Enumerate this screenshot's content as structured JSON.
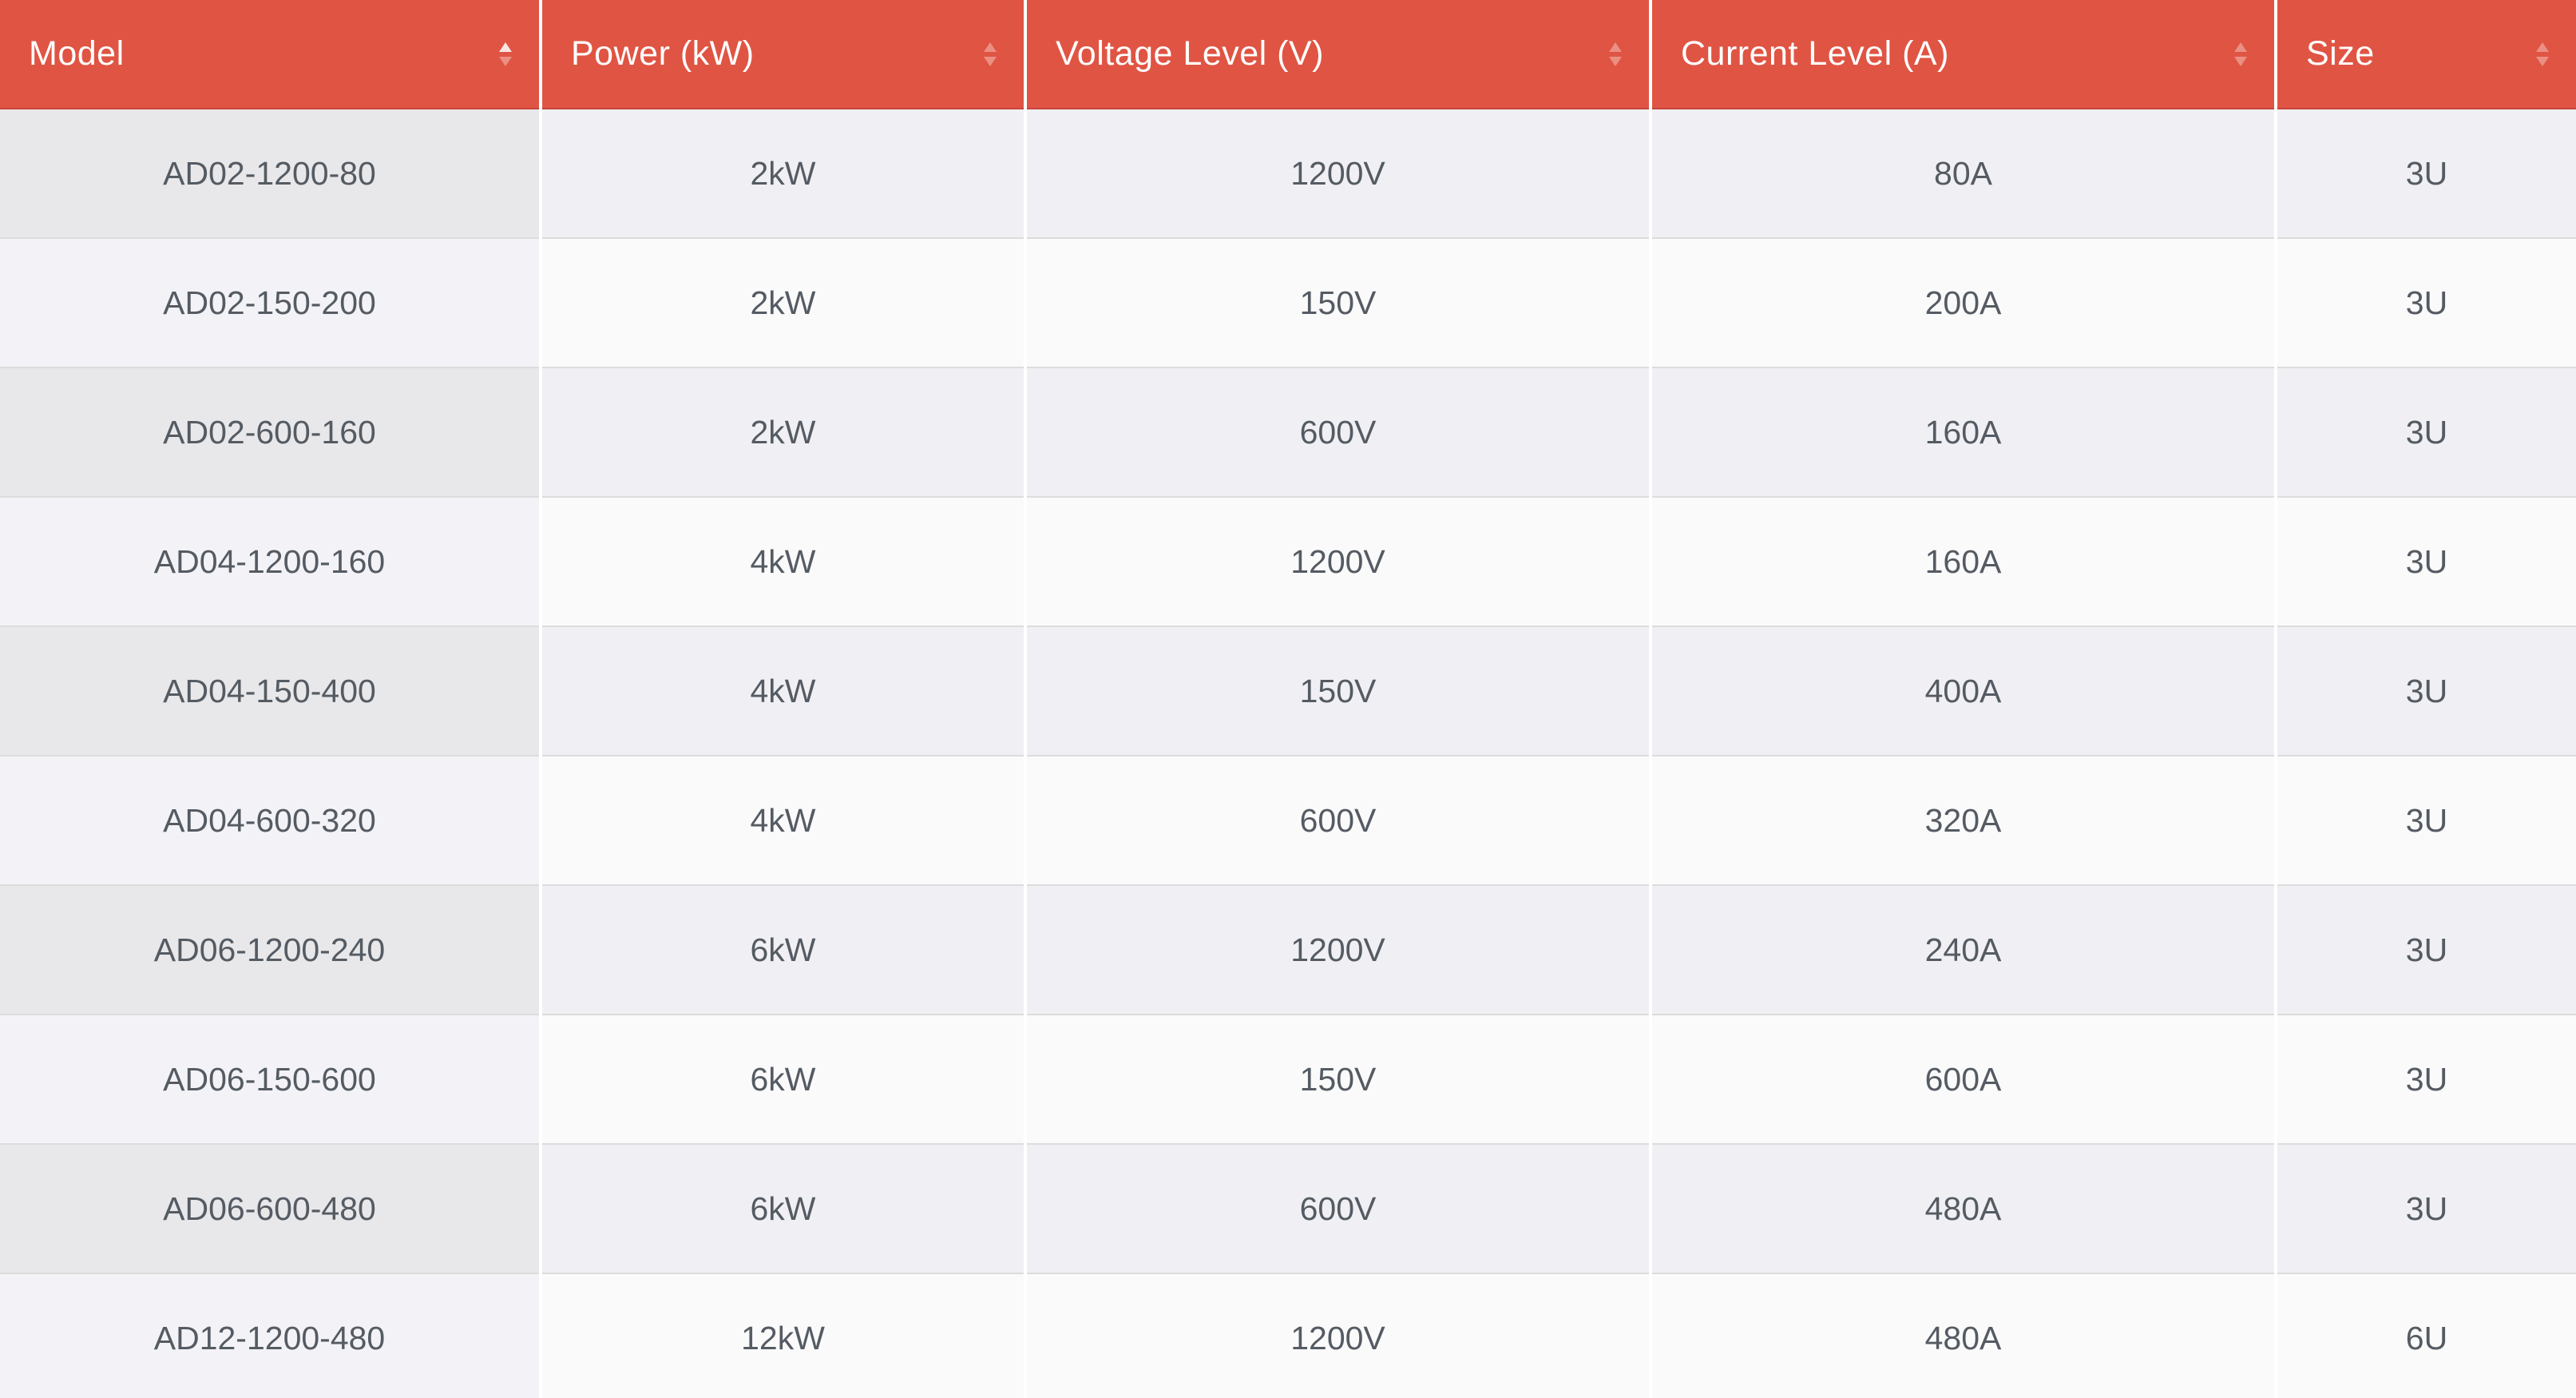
{
  "colors": {
    "header_bg": "#e05443",
    "header_text": "#ffffff",
    "row_odd": "#f0f0f4",
    "row_even": "#fafafa",
    "cell_text": "#555b63"
  },
  "table": {
    "headers": [
      "Model",
      "Power (kW)",
      "Voltage Level (V)",
      "Current Level (A)",
      "Size"
    ],
    "sort_icons": [
      "sort-ascending-icon",
      "sort-icon",
      "sort-icon",
      "sort-icon",
      "sort-icon"
    ],
    "rows": [
      [
        "AD02-1200-80",
        "2kW",
        "1200V",
        "80A",
        "3U"
      ],
      [
        "AD02-150-200",
        "2kW",
        "150V",
        "200A",
        "3U"
      ],
      [
        "AD02-600-160",
        "2kW",
        "600V",
        "160A",
        "3U"
      ],
      [
        "AD04-1200-160",
        "4kW",
        "1200V",
        "160A",
        "3U"
      ],
      [
        "AD04-150-400",
        "4kW",
        "150V",
        "400A",
        "3U"
      ],
      [
        "AD04-600-320",
        "4kW",
        "600V",
        "320A",
        "3U"
      ],
      [
        "AD06-1200-240",
        "6kW",
        "1200V",
        "240A",
        "3U"
      ],
      [
        "AD06-150-600",
        "6kW",
        "150V",
        "600A",
        "3U"
      ],
      [
        "AD06-600-480",
        "6kW",
        "600V",
        "480A",
        "3U"
      ],
      [
        "AD12-1200-480",
        "12kW",
        "1200V",
        "480A",
        "6U"
      ]
    ]
  }
}
